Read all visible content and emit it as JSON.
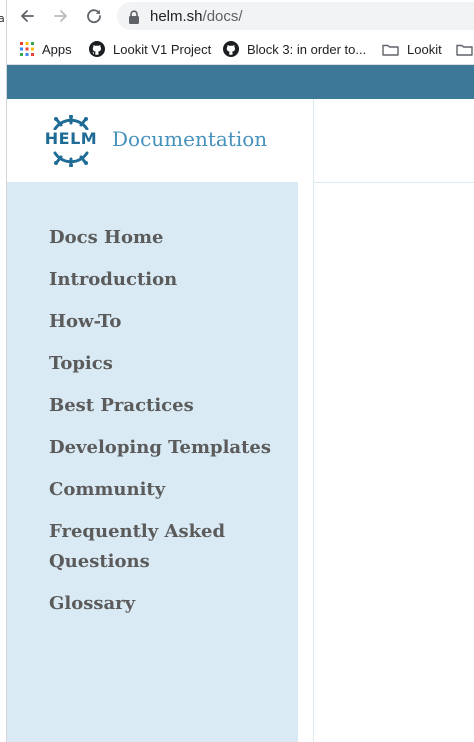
{
  "browser": {
    "url_host": "helm.sh",
    "url_path": "/docs/",
    "left_edge_glyph": "a",
    "icons": {
      "back": "arrow-left-icon",
      "forward": "arrow-right-icon",
      "reload": "reload-icon",
      "lock": "lock-icon"
    }
  },
  "bookmarks": {
    "items": [
      {
        "label": "Apps",
        "icon": "apps-grid-icon"
      },
      {
        "label": "Lookit V1 Project",
        "icon": "github-icon"
      },
      {
        "label": "Block 3: in order to...",
        "icon": "github-icon"
      },
      {
        "label": "Lookit",
        "icon": "folder-icon"
      },
      {
        "label": "",
        "icon": "folder-icon"
      }
    ]
  },
  "page": {
    "brand_color": "#3d7899",
    "sidebar_color": "#d9eaf4",
    "logo_text": "HELM",
    "title": "Documentation",
    "nav": [
      "Docs Home",
      "Introduction",
      "How-To",
      "Topics",
      "Best Practices",
      "Developing Templates",
      "Community",
      "Frequently Asked Questions",
      "Glossary"
    ]
  }
}
